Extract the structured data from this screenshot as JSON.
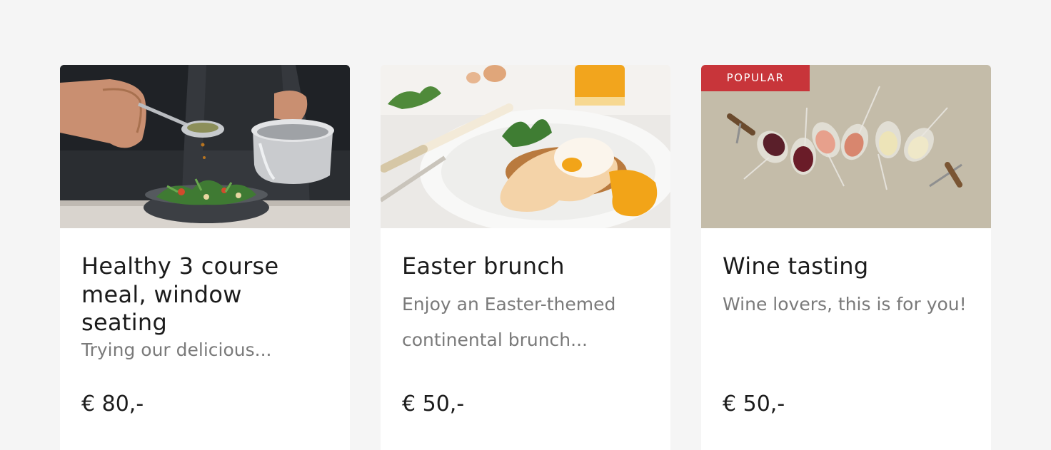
{
  "colors": {
    "page_background": "#f5f5f5",
    "card_background": "#ffffff",
    "badge": "#c8353a",
    "title": "#1b1b1b",
    "description": "#7a7a7a"
  },
  "cards": [
    {
      "image_alt": "chef plating a healthy salad",
      "title": "Healthy 3 course meal, window seating",
      "description": "Trying our delicious...",
      "price": "€ 80,-"
    },
    {
      "image_alt": "eggs benedict brunch plate",
      "title": "Easter brunch",
      "description": "Enjoy an Easter-themed continental brunch...",
      "price": "€ 50,-"
    },
    {
      "badge": "POPULAR",
      "image_alt": "glasses of red, rosé and white wine",
      "title": "Wine tasting",
      "description": "Wine lovers, this is for you!",
      "price": "€ 50,-"
    }
  ]
}
